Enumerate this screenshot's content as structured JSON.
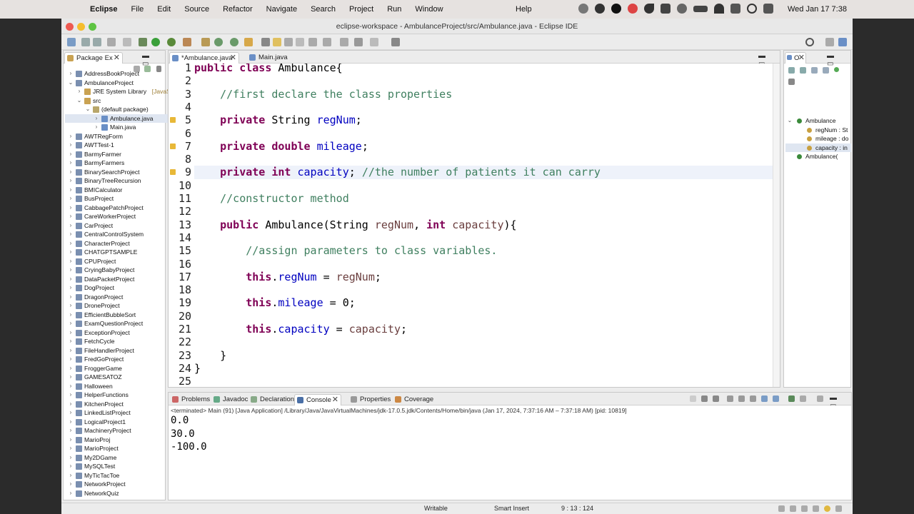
{
  "menubar": {
    "app": "Eclipse",
    "items": [
      "File",
      "Edit",
      "Source",
      "Refactor",
      "Navigate",
      "Search",
      "Project",
      "Run",
      "Window"
    ],
    "help": "Help",
    "clock": "Wed Jan 17  7:38"
  },
  "window": {
    "title": "eclipse-workspace - AmbulanceProject/src/Ambulance.java - Eclipse IDE"
  },
  "package_explorer": {
    "tab_label": "Package Ex",
    "items": [
      {
        "label": "AddressBookProject",
        "depth": 0,
        "arrow": ">"
      },
      {
        "label": "AmbulanceProject",
        "depth": 0,
        "arrow": "v"
      },
      {
        "label": "JRE System Library",
        "suffix": " [JavaSE",
        "depth": 1,
        "arrow": ">"
      },
      {
        "label": "src",
        "depth": 1,
        "arrow": "v"
      },
      {
        "label": "(default package)",
        "depth": 2,
        "arrow": "v"
      },
      {
        "label": "Ambulance.java",
        "depth": 3,
        "arrow": ">",
        "selected": true
      },
      {
        "label": "Main.java",
        "depth": 3,
        "arrow": ">"
      },
      {
        "label": "AWTRegForm",
        "depth": 0,
        "arrow": ">"
      },
      {
        "label": "AWTTest-1",
        "depth": 0,
        "arrow": ">"
      },
      {
        "label": "BarmyFarmer",
        "depth": 0,
        "arrow": ">"
      },
      {
        "label": "BarmyFarmers",
        "depth": 0,
        "arrow": ">"
      },
      {
        "label": "BinarySearchProject",
        "depth": 0,
        "arrow": ">"
      },
      {
        "label": "BinaryTreeRecursion",
        "depth": 0,
        "arrow": ">"
      },
      {
        "label": "BMICalculator",
        "depth": 0,
        "arrow": ">"
      },
      {
        "label": "BusProject",
        "depth": 0,
        "arrow": ">"
      },
      {
        "label": "CabbagePatchProject",
        "depth": 0,
        "arrow": ">"
      },
      {
        "label": "CareWorkerProject",
        "depth": 0,
        "arrow": ">"
      },
      {
        "label": "CarProject",
        "depth": 0,
        "arrow": ">"
      },
      {
        "label": "CentralControlSystem",
        "depth": 0,
        "arrow": ">"
      },
      {
        "label": "CharacterProject",
        "depth": 0,
        "arrow": ">"
      },
      {
        "label": "CHATGPTSAMPLE",
        "depth": 0,
        "arrow": ">"
      },
      {
        "label": "CPUProject",
        "depth": 0,
        "arrow": ">"
      },
      {
        "label": "CryingBabyProject",
        "depth": 0,
        "arrow": ">"
      },
      {
        "label": "DataPacketProject",
        "depth": 0,
        "arrow": ">"
      },
      {
        "label": "DogProject",
        "depth": 0,
        "arrow": ">"
      },
      {
        "label": "DragonProject",
        "depth": 0,
        "arrow": ">"
      },
      {
        "label": "DroneProject",
        "depth": 0,
        "arrow": ">"
      },
      {
        "label": "EfficientBubbleSort",
        "depth": 0,
        "arrow": ">"
      },
      {
        "label": "ExamQuestionProject",
        "depth": 0,
        "arrow": ">"
      },
      {
        "label": "ExceptionProject",
        "depth": 0,
        "arrow": ">"
      },
      {
        "label": "FetchCycle",
        "depth": 0,
        "arrow": ">"
      },
      {
        "label": "FileHandlerProject",
        "depth": 0,
        "arrow": ">"
      },
      {
        "label": "FredGoProject",
        "depth": 0,
        "arrow": ">"
      },
      {
        "label": "FroggerGame",
        "depth": 0,
        "arrow": ">"
      },
      {
        "label": "GAMESATOZ",
        "depth": 0,
        "arrow": ">"
      },
      {
        "label": "Halloween",
        "depth": 0,
        "arrow": ">"
      },
      {
        "label": "HelperFunctions",
        "depth": 0,
        "arrow": ">"
      },
      {
        "label": "KitchenProject",
        "depth": 0,
        "arrow": ">"
      },
      {
        "label": "LinkedListProject",
        "depth": 0,
        "arrow": ">"
      },
      {
        "label": "LogicalProject1",
        "depth": 0,
        "arrow": ">"
      },
      {
        "label": "MachineryProject",
        "depth": 0,
        "arrow": ">"
      },
      {
        "label": "MarioProj",
        "depth": 0,
        "arrow": ">"
      },
      {
        "label": "MarioProject",
        "depth": 0,
        "arrow": ">"
      },
      {
        "label": "My2DGame",
        "depth": 0,
        "arrow": ">"
      },
      {
        "label": "MySQLTest",
        "depth": 0,
        "arrow": ">"
      },
      {
        "label": "MyTicTacToe",
        "depth": 0,
        "arrow": ">"
      },
      {
        "label": "NetworkProject",
        "depth": 0,
        "arrow": ">"
      },
      {
        "label": "NetworkQuiz",
        "depth": 0,
        "arrow": ">"
      }
    ]
  },
  "editor": {
    "tabs": [
      {
        "label": "*Ambulance.java",
        "active": true
      },
      {
        "label": "Main.java",
        "active": false
      }
    ],
    "current_line": 9,
    "warning_lines": [
      5,
      7,
      9
    ],
    "lines": [
      [
        [
          "kw",
          "public"
        ],
        [
          "t",
          " "
        ],
        [
          "kw",
          "class"
        ],
        [
          "t",
          " Ambulance{"
        ]
      ],
      [],
      [
        [
          "t",
          "    "
        ],
        [
          "cm",
          "//first declare the class properties"
        ]
      ],
      [],
      [
        [
          "t",
          "    "
        ],
        [
          "kw",
          "private"
        ],
        [
          "t",
          " String "
        ],
        [
          "fld",
          "regNum"
        ],
        [
          "t",
          ";"
        ]
      ],
      [],
      [
        [
          "t",
          "    "
        ],
        [
          "kw",
          "private"
        ],
        [
          "t",
          " "
        ],
        [
          "kw",
          "double"
        ],
        [
          "t",
          " "
        ],
        [
          "fld",
          "mileage"
        ],
        [
          "t",
          ";"
        ]
      ],
      [],
      [
        [
          "t",
          "    "
        ],
        [
          "kw",
          "private"
        ],
        [
          "t",
          " "
        ],
        [
          "kw",
          "int"
        ],
        [
          "t",
          " "
        ],
        [
          "fld",
          "capacity"
        ],
        [
          "t",
          "; "
        ],
        [
          "cm",
          "//the number of patients it can carry"
        ]
      ],
      [],
      [
        [
          "t",
          "    "
        ],
        [
          "cm",
          "//constructor method"
        ]
      ],
      [],
      [
        [
          "t",
          "    "
        ],
        [
          "kw",
          "public"
        ],
        [
          "t",
          " Ambulance(String "
        ],
        [
          "vr",
          "regNum"
        ],
        [
          "t",
          ", "
        ],
        [
          "kw",
          "int"
        ],
        [
          "t",
          " "
        ],
        [
          "vr",
          "capacity"
        ],
        [
          "t",
          "){"
        ]
      ],
      [],
      [
        [
          "t",
          "        "
        ],
        [
          "cm",
          "//assign parameters to class variables."
        ]
      ],
      [],
      [
        [
          "t",
          "        "
        ],
        [
          "kw",
          "this"
        ],
        [
          "t",
          "."
        ],
        [
          "fld",
          "regNum"
        ],
        [
          "t",
          " = "
        ],
        [
          "vr",
          "regNum"
        ],
        [
          "t",
          ";"
        ]
      ],
      [],
      [
        [
          "t",
          "        "
        ],
        [
          "kw",
          "this"
        ],
        [
          "t",
          "."
        ],
        [
          "fld",
          "mileage"
        ],
        [
          "t",
          " = 0;"
        ]
      ],
      [],
      [
        [
          "t",
          "        "
        ],
        [
          "kw",
          "this"
        ],
        [
          "t",
          "."
        ],
        [
          "fld",
          "capacity"
        ],
        [
          "t",
          " = "
        ],
        [
          "vr",
          "capacity"
        ],
        [
          "t",
          ";"
        ]
      ],
      [],
      [
        [
          "t",
          "    }"
        ]
      ],
      [
        [
          "t",
          "}"
        ]
      ],
      []
    ]
  },
  "outline": {
    "tab_label": "O",
    "items": [
      {
        "label": "Ambulance",
        "depth": 0,
        "arrow": "v",
        "color": "#3a8a3a"
      },
      {
        "label": "regNum : St",
        "depth": 1,
        "color": "#c8a040"
      },
      {
        "label": "mileage : do",
        "depth": 1,
        "color": "#c8a040"
      },
      {
        "label": "capacity : in",
        "depth": 1,
        "color": "#c8a040",
        "selected": true
      },
      {
        "label": "Ambulance(",
        "depth": 0,
        "color": "#3a8a3a",
        "prefix": "c"
      }
    ]
  },
  "bottom": {
    "tabs": [
      {
        "label": "Problems"
      },
      {
        "label": "Javadoc"
      },
      {
        "label": "Declaration"
      },
      {
        "label": "Console",
        "active": true
      },
      {
        "label": "Properties"
      },
      {
        "label": "Coverage"
      }
    ],
    "console_header": "<terminated> Main (91) [Java Application] /Library/Java/JavaVirtualMachines/jdk-17.0.5.jdk/Contents/Home/bin/java  (Jan 17, 2024, 7:37:16 AM – 7:37:18 AM) [pid: 10819]",
    "output": [
      "0.0",
      "30.0",
      "-100.0"
    ]
  },
  "status": {
    "writable": "Writable",
    "insert": "Smart Insert",
    "position": "9 : 13 : 124"
  },
  "colors": {
    "keyword": "#7f0055",
    "comment": "#3f7f5f",
    "field": "#0000c0",
    "selection": "#dfe6f1"
  }
}
